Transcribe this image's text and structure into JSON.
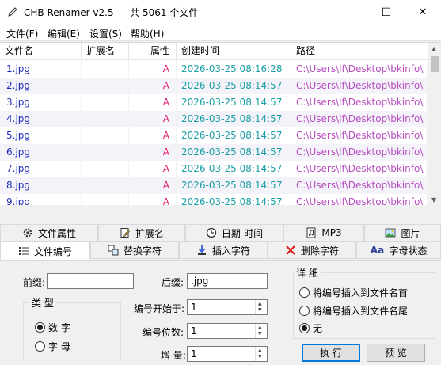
{
  "window": {
    "title": "CHB Renamer v2.5 --- 共 5061 个文件",
    "minimize_glyph": "—",
    "maximize_glyph": "☐",
    "close_glyph": "✕"
  },
  "menu": [
    "文件(F)",
    "编辑(E)",
    "设置(S)",
    "帮助(H)"
  ],
  "list": {
    "columns": [
      "文件名",
      "扩展名",
      "属性",
      "创建时间",
      "路径"
    ],
    "rows": [
      {
        "name": "1.jpg",
        "ext": "",
        "attr": "A",
        "created": "2026-03-25 08:16:28",
        "path": "C:\\Users\\lf\\Desktop\\bkinfo\\"
      },
      {
        "name": "2.jpg",
        "ext": "",
        "attr": "A",
        "created": "2026-03-25 08:14:57",
        "path": "C:\\Users\\lf\\Desktop\\bkinfo\\"
      },
      {
        "name": "3.jpg",
        "ext": "",
        "attr": "A",
        "created": "2026-03-25 08:14:57",
        "path": "C:\\Users\\lf\\Desktop\\bkinfo\\"
      },
      {
        "name": "4.jpg",
        "ext": "",
        "attr": "A",
        "created": "2026-03-25 08:14:57",
        "path": "C:\\Users\\lf\\Desktop\\bkinfo\\"
      },
      {
        "name": "5.jpg",
        "ext": "",
        "attr": "A",
        "created": "2026-03-25 08:14:57",
        "path": "C:\\Users\\lf\\Desktop\\bkinfo\\"
      },
      {
        "name": "6.jpg",
        "ext": "",
        "attr": "A",
        "created": "2026-03-25 08:14:57",
        "path": "C:\\Users\\lf\\Desktop\\bkinfo\\"
      },
      {
        "name": "7.jpg",
        "ext": "",
        "attr": "A",
        "created": "2026-03-25 08:14:57",
        "path": "C:\\Users\\lf\\Desktop\\bkinfo\\"
      },
      {
        "name": "8.jpg",
        "ext": "",
        "attr": "A",
        "created": "2026-03-25 08:14:57",
        "path": "C:\\Users\\lf\\Desktop\\bkinfo\\"
      },
      {
        "name": "9.jpg",
        "ext": "",
        "attr": "A",
        "created": "2026-03-25 08:14:57",
        "path": "C:\\Users\\lf\\Desktop\\bkinfo\\"
      }
    ]
  },
  "tabs": {
    "row1": [
      {
        "label": "文件属性",
        "icon": "gear-icon"
      },
      {
        "label": "扩展名",
        "icon": "edit-doc-icon"
      },
      {
        "label": "日期-时间",
        "icon": "clock-icon"
      },
      {
        "label": "MP3",
        "icon": "music-file-icon"
      },
      {
        "label": "图片",
        "icon": "picture-icon"
      }
    ],
    "row2": [
      {
        "label": "文件编号",
        "icon": "numbered-list-icon",
        "active": true
      },
      {
        "label": "替换字符",
        "icon": "replace-icon"
      },
      {
        "label": "插入字符",
        "icon": "insert-arrow-icon"
      },
      {
        "label": "删除字符",
        "icon": "delete-x-icon"
      },
      {
        "label": "字母状态",
        "icon": "letter-case-icon"
      }
    ]
  },
  "numbering": {
    "prefix_label": "前缀:",
    "prefix_value": "",
    "suffix_label": "后缀:",
    "suffix_value": ".jpg",
    "type_group_title": "类 型",
    "type_number": "数 字",
    "type_letter": "字 母",
    "selected_type": "数 字",
    "start_label": "编号开始于:",
    "start_value": "1",
    "digits_label": "编号位数:",
    "digits_value": "1",
    "increment_label": "增 量:",
    "increment_value": "1",
    "detail_group_title": "详 细",
    "opt_insert_start": "将编号插入到文件名首",
    "opt_insert_end": "将编号插入到文件名尾",
    "opt_none": "无",
    "selected_detail": "无",
    "execute_label": "执 行",
    "preview_label": "预 览"
  },
  "colors": {
    "name": "#1c2db8",
    "attr": "#e0196e",
    "time": "#1b9fa6",
    "path": "#b84ec0",
    "accent": "#0078d7"
  }
}
